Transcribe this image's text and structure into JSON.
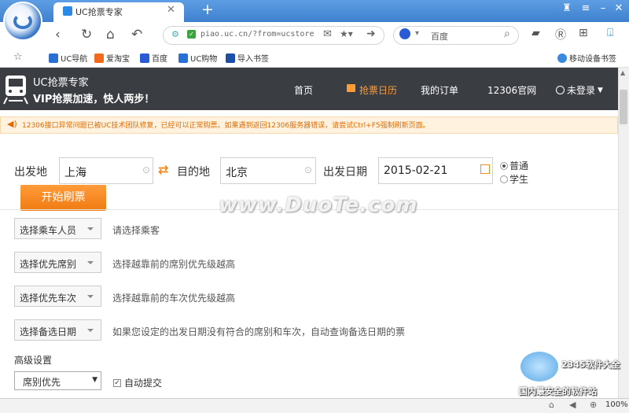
{
  "browser": {
    "tab_title": "UC抢票专家",
    "address": "piao.uc.cn/?from=ucstore",
    "search_text": "百度",
    "zoom": "100%"
  },
  "bookmarks": [
    {
      "label": "UC导航",
      "color": "#2a6fd6"
    },
    {
      "label": "爱淘宝",
      "color": "#f26a1b"
    },
    {
      "label": "百度",
      "color": "#2a5bd6"
    },
    {
      "label": "UC购物",
      "color": "#2a6fd6"
    },
    {
      "label": "导入书签",
      "color": "#1d4fa8"
    }
  ],
  "mobile_bookmarks": "移动设备书签",
  "site": {
    "title": "UC抢票专家",
    "subtitle": "VIP抢票加速，快人两步！",
    "nav": [
      "首页",
      "抢票日历",
      "我的订单",
      "12306官网"
    ],
    "login": "未登录"
  },
  "notice": "12306接口异常问题已被UC技术团队修复，已经可以正常购票。如果遇到返回12306服务器错误，请尝试Ctrl+F5强制刷新页面。",
  "form": {
    "from_label": "出发地",
    "from_value": "上海",
    "to_label": "目的地",
    "to_value": "北京",
    "date_label": "出发日期",
    "date_value": "2015-02-21",
    "ticket_types": [
      "普通",
      "学生"
    ],
    "start_button": "开始刷票"
  },
  "options": [
    {
      "select": "选择乘车人员",
      "hint": "请选择乘客"
    },
    {
      "select": "选择优先席别",
      "hint": "选择越靠前的席别优先级越高"
    },
    {
      "select": "选择优先车次",
      "hint": "选择越靠前的车次优先级越高"
    },
    {
      "select": "选择备选日期",
      "hint": "如果您设定的出发日期没有符合的席别和车次，自动查询备选日期的票"
    }
  ],
  "advanced": {
    "label": "高级设置",
    "seat_priority": "席别优先",
    "auto_submit": "自动提交"
  },
  "watermarks": {
    "main": "www.DuoTe.com",
    "brand": "2345软件大全",
    "slogan": "国内最安全的软件站"
  },
  "colors": {
    "accent": "#f07b12",
    "header_bg": "#3a3d42",
    "browser_blue": "#3f80cf"
  }
}
